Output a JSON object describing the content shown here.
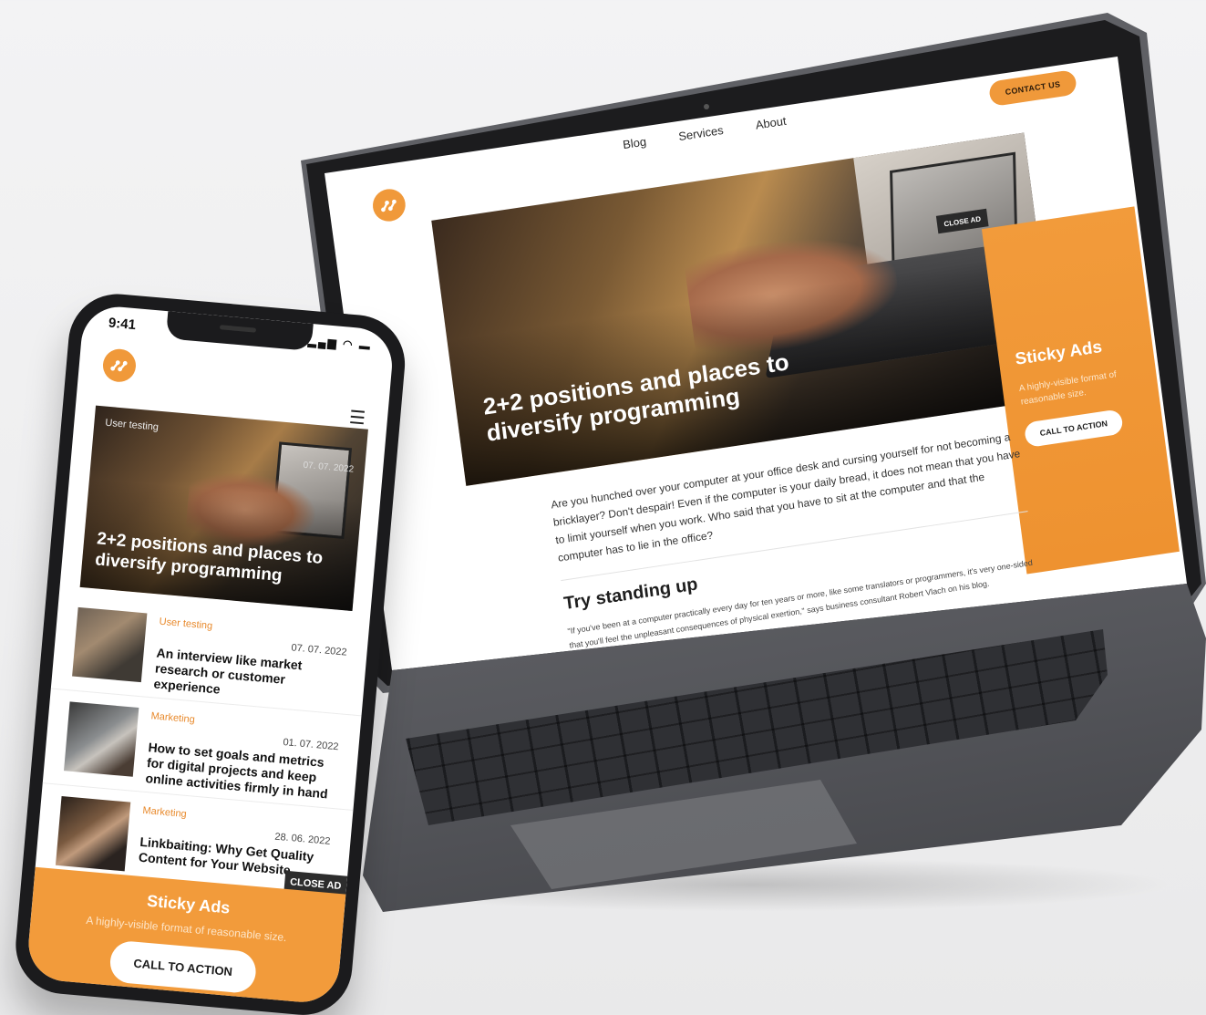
{
  "laptop": {
    "nav": [
      "Blog",
      "Services",
      "About"
    ],
    "contact_label": "CONTACT US",
    "hero_title": "2+2 positions and places to diversify programming",
    "close_ad_label": "CLOSE AD",
    "sticky_ad": {
      "title": "Sticky Ads",
      "subtitle": "A highly-visible format of reasonable size.",
      "cta": "CALL TO ACTION"
    },
    "article": {
      "intro": "Are you hunched over your computer at your office desk and cursing yourself  for not becoming a bricklayer? Don't despair! Even if the computer is your daily bread, it does not mean that you have to limit yourself when you work. Who said that you have to sit at the computer and that the computer has to lie in the office?",
      "heading": "Try standing up",
      "quote": "\"If you've been at a computer practically every day for ten years or more, like some translators or programmers, it's very one-sided that you'll feel the unpleasant consequences of physical exertion,\" says business consultant Robert Vlach on his blog."
    }
  },
  "phone": {
    "time": "9:41",
    "status_icons": "signal-wifi-battery",
    "hero": {
      "category": "User testing",
      "date": "07. 07. 2022",
      "title": "2+2 positions and places to diversify programming"
    },
    "articles": [
      {
        "category": "User testing",
        "date": "07. 07. 2022",
        "title": "An interview like market research or customer experience"
      },
      {
        "category": "Marketing",
        "date": "01. 07. 2022",
        "title": "How to set goals and metrics for digital projects and keep online activities firmly in hand"
      },
      {
        "category": "Marketing",
        "date": "28. 06. 2022",
        "title": "Linkbaiting: Why Get Quality Content for Your Website"
      }
    ],
    "close_ad_label": "CLOSE AD",
    "sticky_ad": {
      "title": "Sticky Ads",
      "subtitle": "A highly-visible format of reasonable size.",
      "cta": "CALL TO ACTION"
    }
  },
  "colors": {
    "accent": "#f0993a",
    "dark": "#1c1c1e",
    "background": "#f0f0f1"
  },
  "icons": [
    "logo-icon",
    "menu-icon",
    "signal-icon",
    "wifi-icon",
    "battery-icon"
  ]
}
